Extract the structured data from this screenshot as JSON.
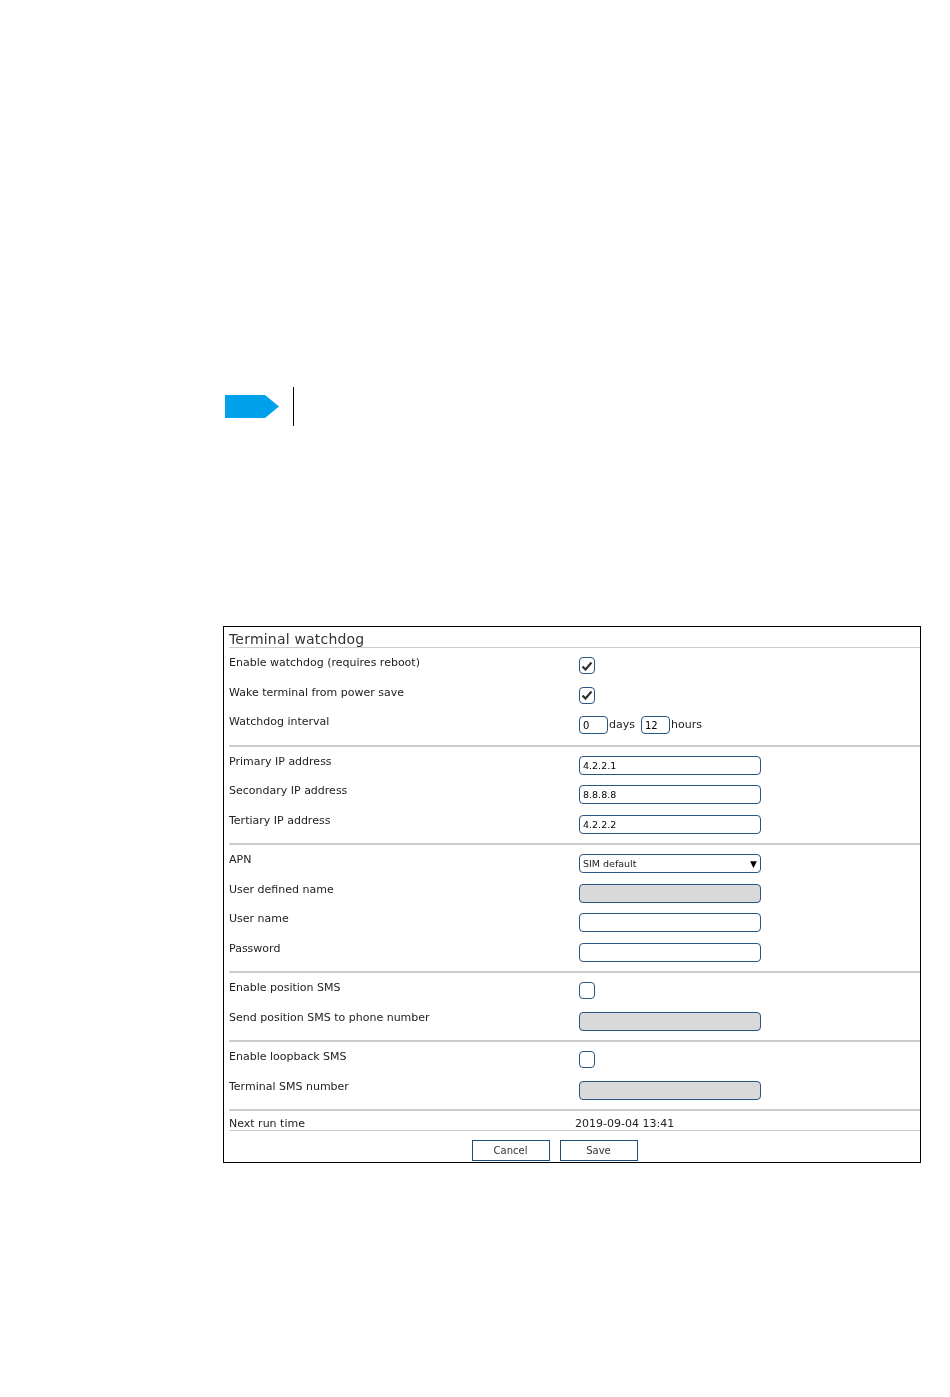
{
  "form": {
    "title": "Terminal watchdog",
    "sections": [
      {
        "rows": [
          {
            "kind": "checkbox",
            "label": "Enable watchdog (requires reboot)",
            "checked": true
          },
          {
            "kind": "checkbox",
            "label": "Wake terminal from power save",
            "checked": true
          },
          {
            "kind": "interval",
            "label": "Watchdog interval",
            "days": "0",
            "days_unit": "days",
            "hours": "12",
            "hours_unit": "hours"
          }
        ]
      },
      {
        "rows": [
          {
            "kind": "text",
            "label": "Primary IP address",
            "value": "4.2.2.1",
            "disabled": false
          },
          {
            "kind": "text",
            "label": "Secondary IP address",
            "value": "8.8.8.8",
            "disabled": false
          },
          {
            "kind": "text",
            "label": "Tertiary IP address",
            "value": "4.2.2.2",
            "disabled": false
          }
        ]
      },
      {
        "rows": [
          {
            "kind": "select",
            "label": "APN",
            "value": "SIM default",
            "arrow": "▼"
          },
          {
            "kind": "text",
            "label": "User defined name",
            "disabled": true
          },
          {
            "kind": "text",
            "label": "User name",
            "disabled": false
          },
          {
            "kind": "password",
            "label": "Password",
            "disabled": false
          }
        ]
      },
      {
        "rows": [
          {
            "kind": "checkbox",
            "label": "Enable position SMS",
            "checked": false
          },
          {
            "kind": "text",
            "label": "Send position SMS to phone number",
            "disabled": true
          }
        ]
      },
      {
        "rows": [
          {
            "kind": "checkbox",
            "label": "Enable loopback SMS",
            "checked": false
          },
          {
            "kind": "text",
            "label": "Terminal SMS number",
            "disabled": true
          }
        ]
      }
    ],
    "next_run": {
      "label": "Next run time",
      "value": "2019-09-04 13:41"
    },
    "buttons": [
      "Cancel",
      "Save"
    ]
  }
}
